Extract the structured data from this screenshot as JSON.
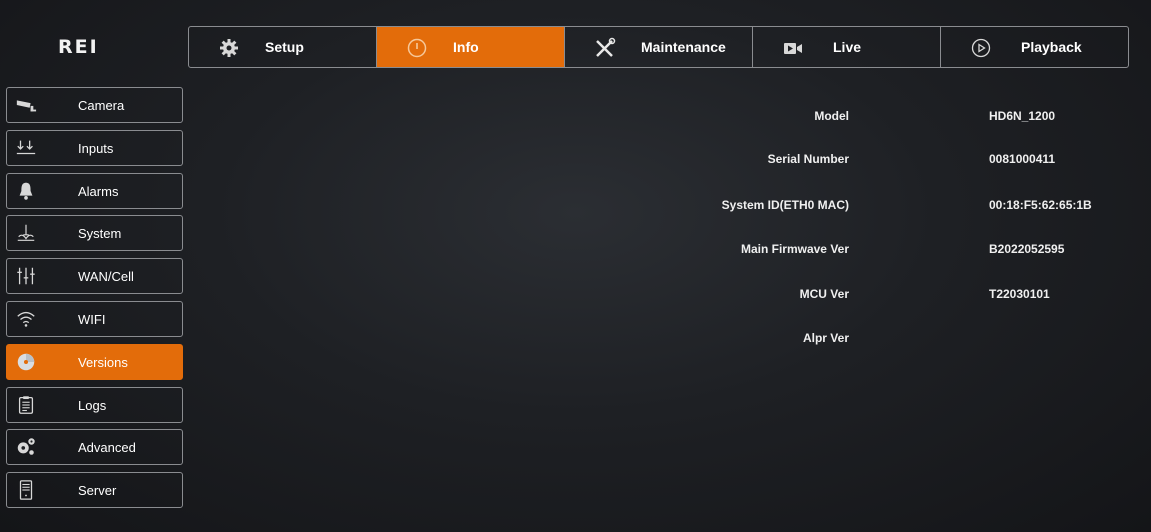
{
  "brand": {
    "logo_text": "REI"
  },
  "topnav": {
    "tabs": [
      {
        "label": "Setup",
        "icon": "gear-icon",
        "active": false
      },
      {
        "label": "Info",
        "icon": "info-circle-icon",
        "active": true
      },
      {
        "label": "Maintenance",
        "icon": "tools-icon",
        "active": false
      },
      {
        "label": "Live",
        "icon": "video-camera-icon",
        "active": false
      },
      {
        "label": "Playback",
        "icon": "play-circle-icon",
        "active": false
      }
    ]
  },
  "sidebar": {
    "items": [
      {
        "label": "Camera",
        "icon": "security-camera-icon",
        "active": false
      },
      {
        "label": "Inputs",
        "icon": "input-arrows-icon",
        "active": false
      },
      {
        "label": "Alarms",
        "icon": "bell-icon",
        "active": false
      },
      {
        "label": "System",
        "icon": "system-icon",
        "active": false
      },
      {
        "label": "WAN/Cell",
        "icon": "sliders-icon",
        "active": false
      },
      {
        "label": "WIFI",
        "icon": "wifi-icon",
        "active": false
      },
      {
        "label": "Versions",
        "icon": "disc-icon",
        "active": true
      },
      {
        "label": "Logs",
        "icon": "clipboard-icon",
        "active": false
      },
      {
        "label": "Advanced",
        "icon": "gears-icon",
        "active": false
      },
      {
        "label": "Server",
        "icon": "server-icon",
        "active": false
      }
    ]
  },
  "versions": {
    "rows": [
      {
        "label": "Model",
        "value": "HD6N_1200"
      },
      {
        "label": "Serial Number",
        "value": "0081000411"
      },
      {
        "label": "System ID(ETH0 MAC)",
        "value": "00:18:F5:62:65:1B"
      },
      {
        "label": "Main Firmwave Ver",
        "value": "B2022052595"
      },
      {
        "label": "MCU Ver",
        "value": "T22030101"
      },
      {
        "label": "Alpr Ver",
        "value": ""
      }
    ]
  },
  "colors": {
    "accent": "#e36c0a",
    "border": "#8a8c90",
    "background": "#1e2024"
  }
}
